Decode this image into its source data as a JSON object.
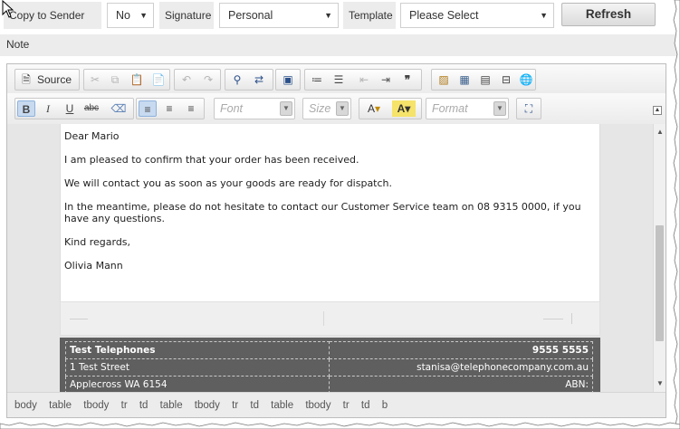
{
  "form": {
    "copy_to_sender_label": "Copy to Sender",
    "copy_to_sender_value": "No",
    "signature_label": "Signature",
    "signature_value": "Personal",
    "template_label": "Template",
    "template_value": "Please Select",
    "refresh_label": "Refresh",
    "note_label": "Note"
  },
  "toolbar": {
    "source_label": "Source",
    "font_placeholder": "Font",
    "size_placeholder": "Size",
    "format_placeholder": "Format",
    "icons": [
      "source-icon",
      "cut-icon",
      "copy-icon",
      "paste-icon",
      "paste-from-word-icon",
      "undo-icon",
      "redo-icon",
      "find-icon",
      "replace-icon",
      "select-all-icon",
      "numbered-list-icon",
      "bulleted-list-icon",
      "outdent-icon",
      "indent-icon",
      "blockquote-icon",
      "image-icon",
      "table-icon",
      "horizontal-line-icon",
      "page-break-icon",
      "link-icon",
      "bold-icon",
      "italic-icon",
      "underline-icon",
      "strikethrough-icon",
      "remove-format-icon",
      "align-left-icon",
      "align-center-icon",
      "align-right-icon",
      "text-color-icon",
      "background-color-icon",
      "maximize-icon"
    ]
  },
  "body": {
    "greeting": "Dear Mario",
    "p1": "I am pleased to confirm that your order has been received.",
    "p2": "We will contact you as soon as your goods are ready for dispatch.",
    "p3": "In the meantime, please do not hesitate to contact our Customer Service team on 08 9315 0000, if you have any questions.",
    "closing": "Kind regards,",
    "sender": "Olivia Mann"
  },
  "signature_table": {
    "company": "Test Telephones",
    "phone": "9555 5555",
    "street": "1 Test Street",
    "email": "stanisa@telephonecompany.com.au",
    "suburb": "Applecross WA 6154",
    "abn": "ABN:"
  },
  "path": [
    "body",
    "table",
    "tbody",
    "tr",
    "td",
    "table",
    "tbody",
    "tr",
    "td",
    "table",
    "tbody",
    "tr",
    "td",
    "b",
    ""
  ],
  "colors": {
    "signature_background": "#5f5f5f",
    "active_button_background": "#c8daf0",
    "label_background": "#ececec"
  }
}
